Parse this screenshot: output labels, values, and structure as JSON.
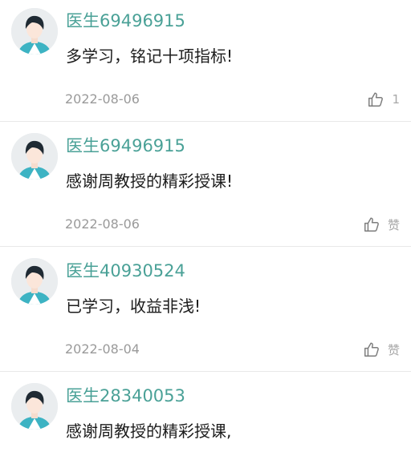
{
  "colors": {
    "username": "#4aa197",
    "comment_text": "#1c1c1c",
    "date": "#9a9a9a",
    "like": "#a8a8a8",
    "divider": "#e8e8e8"
  },
  "comments": [
    {
      "avatar_icon": "doctor-avatar-icon",
      "username": "医生69496915",
      "text": "多学习，铭记十项指标!",
      "date": "2022-08-06",
      "like_icon": "thumbs-up-icon",
      "like_label": "1"
    },
    {
      "avatar_icon": "doctor-avatar-icon",
      "username": "医生69496915",
      "text": "感谢周教授的精彩授课!",
      "date": "2022-08-06",
      "like_icon": "thumbs-up-icon",
      "like_label": "赞"
    },
    {
      "avatar_icon": "doctor-avatar-icon",
      "username": "医生40930524",
      "text": "已学习，收益非浅!",
      "date": "2022-08-04",
      "like_icon": "thumbs-up-icon",
      "like_label": "赞"
    },
    {
      "avatar_icon": "doctor-avatar-icon",
      "username": "医生28340053",
      "text": "感谢周教授的精彩授课,",
      "date": "",
      "like_icon": "",
      "like_label": ""
    }
  ]
}
